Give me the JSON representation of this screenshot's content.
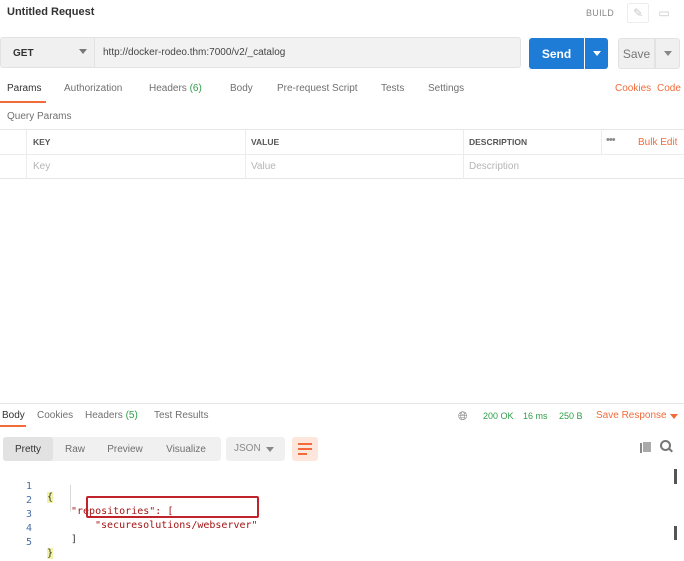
{
  "title_bar": {
    "title": "Untitled Request",
    "build_label": "BUILD",
    "edit_icon": "pencil-icon",
    "comment_icon": "comment-icon"
  },
  "request": {
    "method": "GET",
    "url": "http://docker-rodeo.thm:7000/v2/_catalog",
    "send_label": "Send",
    "save_label": "Save"
  },
  "request_tabs": {
    "items": [
      {
        "label": "Params",
        "count": ""
      },
      {
        "label": "Authorization",
        "count": ""
      },
      {
        "label": "Headers",
        "count": "(6)"
      },
      {
        "label": "Body",
        "count": ""
      },
      {
        "label": "Pre-request Script",
        "count": ""
      },
      {
        "label": "Tests",
        "count": ""
      },
      {
        "label": "Settings",
        "count": ""
      }
    ],
    "active": "Params",
    "cookies_label": "Cookies",
    "code_label": "Code"
  },
  "query_params": {
    "section_label": "Query Params",
    "headers": [
      "KEY",
      "VALUE",
      "DESCRIPTION"
    ],
    "placeholders": [
      "Key",
      "Value",
      "Description"
    ],
    "more_label": "•••",
    "bulk_edit_label": "Bulk Edit"
  },
  "response": {
    "tabs": [
      {
        "label": "Body",
        "count": ""
      },
      {
        "label": "Cookies",
        "count": ""
      },
      {
        "label": "Headers",
        "count": "(5)"
      },
      {
        "label": "Test Results",
        "count": ""
      }
    ],
    "active_tab": "Body",
    "status": "200 OK",
    "time": "16 ms",
    "size": "250 B",
    "save_response_label": "Save Response",
    "view_modes": [
      "Pretty",
      "Raw",
      "Preview",
      "Visualize"
    ],
    "active_view": "Pretty",
    "format": "JSON",
    "code_lines": [
      {
        "num": "1",
        "text": "{"
      },
      {
        "num": "2",
        "text": "\"repositories\": ["
      },
      {
        "num": "3",
        "text": "\"securesolutions/webserver\""
      },
      {
        "num": "4",
        "text": "]"
      },
      {
        "num": "5",
        "text": "}"
      }
    ],
    "accent_color": "#f26b3a",
    "send_color": "#1e7bd6",
    "status_color": "#2e9f4a"
  }
}
